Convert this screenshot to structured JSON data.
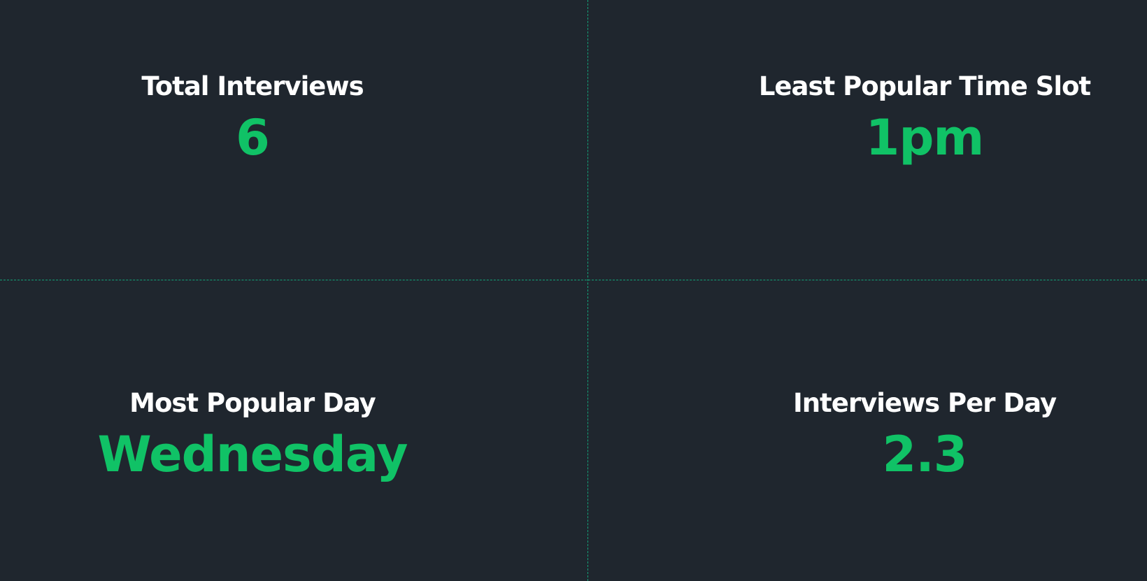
{
  "stats": [
    {
      "label": "Total Interviews",
      "value": "6"
    },
    {
      "label": "Least Popular Time Slot",
      "value": "1pm"
    },
    {
      "label": "Most Popular Day",
      "value": "Wednesday"
    },
    {
      "label": "Interviews Per Day",
      "value": "2.3"
    }
  ],
  "colors": {
    "background": "#1f262e",
    "label": "#ffffff",
    "value": "#10c266",
    "divider": "#12b886"
  }
}
